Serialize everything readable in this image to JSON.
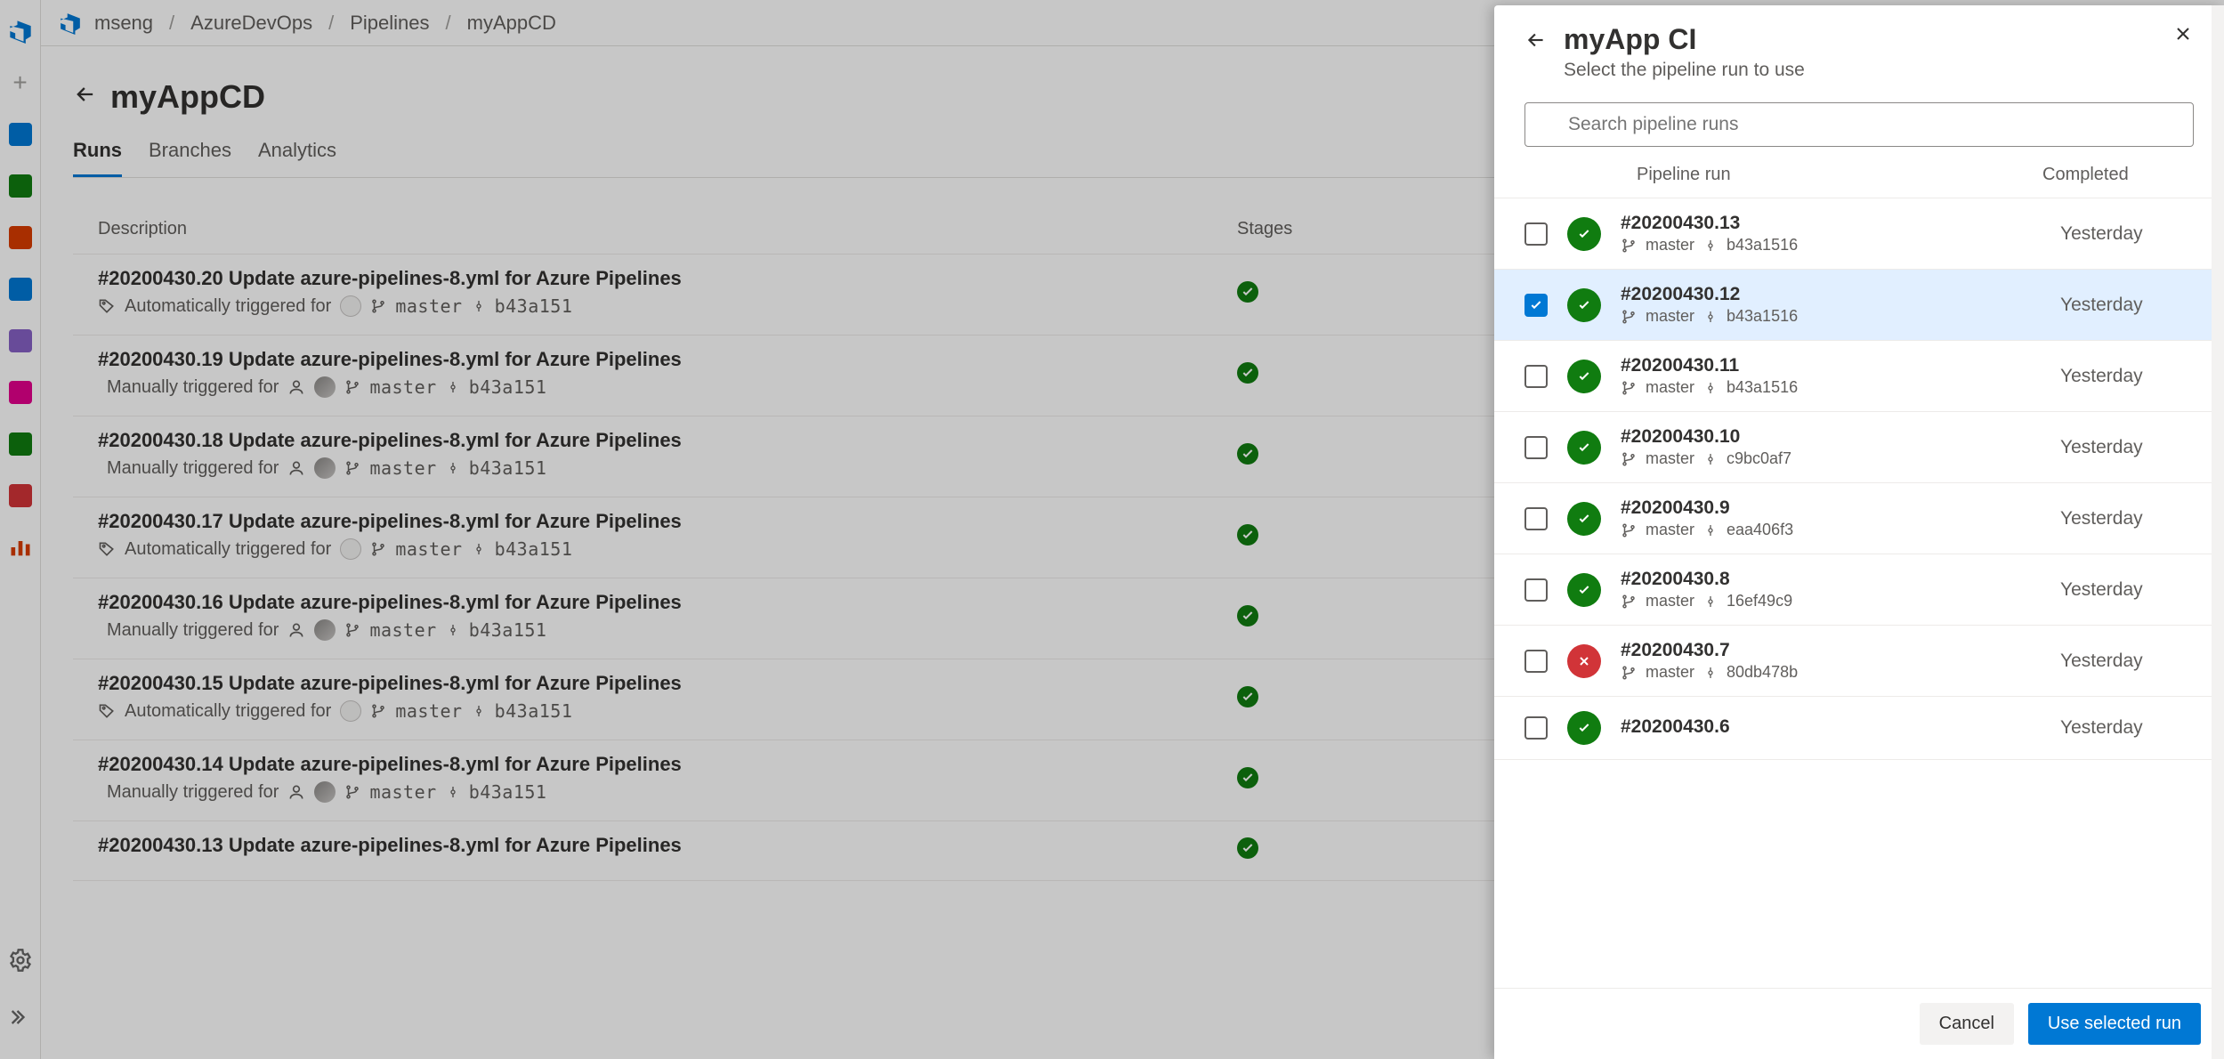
{
  "breadcrumbs": [
    "mseng",
    "AzureDevOps",
    "Pipelines",
    "myAppCD"
  ],
  "page": {
    "title": "myAppCD"
  },
  "tabs": [
    {
      "label": "Runs",
      "selected": true
    },
    {
      "label": "Branches",
      "selected": false
    },
    {
      "label": "Analytics",
      "selected": false
    }
  ],
  "runs_header": {
    "description": "Description",
    "stages": "Stages"
  },
  "runs": [
    {
      "title": "#20200430.20 Update azure-pipelines-8.yml for Azure Pipelines",
      "trigger": "Automatically triggered for",
      "trigger_icon": "app",
      "branch": "master",
      "commit": "b43a151",
      "status": "success"
    },
    {
      "title": "#20200430.19 Update azure-pipelines-8.yml for Azure Pipelines",
      "trigger": "Manually triggered for",
      "trigger_icon": "user",
      "branch": "master",
      "commit": "b43a151",
      "status": "success"
    },
    {
      "title": "#20200430.18 Update azure-pipelines-8.yml for Azure Pipelines",
      "trigger": "Manually triggered for",
      "trigger_icon": "user",
      "branch": "master",
      "commit": "b43a151",
      "status": "success"
    },
    {
      "title": "#20200430.17 Update azure-pipelines-8.yml for Azure Pipelines",
      "trigger": "Automatically triggered for",
      "trigger_icon": "app",
      "branch": "master",
      "commit": "b43a151",
      "status": "success"
    },
    {
      "title": "#20200430.16 Update azure-pipelines-8.yml for Azure Pipelines",
      "trigger": "Manually triggered for",
      "trigger_icon": "user",
      "branch": "master",
      "commit": "b43a151",
      "status": "success"
    },
    {
      "title": "#20200430.15 Update azure-pipelines-8.yml for Azure Pipelines",
      "trigger": "Automatically triggered for",
      "trigger_icon": "app",
      "branch": "master",
      "commit": "b43a151",
      "status": "success"
    },
    {
      "title": "#20200430.14 Update azure-pipelines-8.yml for Azure Pipelines",
      "trigger": "Manually triggered for",
      "trigger_icon": "user",
      "branch": "master",
      "commit": "b43a151",
      "status": "success"
    },
    {
      "title": "#20200430.13 Update azure-pipelines-8.yml for Azure Pipelines",
      "trigger": "",
      "trigger_icon": "",
      "branch": "",
      "commit": "",
      "status": "success"
    }
  ],
  "panel": {
    "title": "myApp CI",
    "subtitle": "Select the pipeline run to use",
    "search_placeholder": "Search pipeline runs",
    "col_run": "Pipeline run",
    "col_completed": "Completed",
    "cancel_label": "Cancel",
    "use_label": "Use selected run",
    "runs": [
      {
        "name": "#20200430.13",
        "branch": "master",
        "commit": "b43a1516",
        "completed": "Yesterday",
        "status": "success",
        "selected": false
      },
      {
        "name": "#20200430.12",
        "branch": "master",
        "commit": "b43a1516",
        "completed": "Yesterday",
        "status": "success",
        "selected": true
      },
      {
        "name": "#20200430.11",
        "branch": "master",
        "commit": "b43a1516",
        "completed": "Yesterday",
        "status": "success",
        "selected": false
      },
      {
        "name": "#20200430.10",
        "branch": "master",
        "commit": "c9bc0af7",
        "completed": "Yesterday",
        "status": "success",
        "selected": false
      },
      {
        "name": "#20200430.9",
        "branch": "master",
        "commit": "eaa406f3",
        "completed": "Yesterday",
        "status": "success",
        "selected": false
      },
      {
        "name": "#20200430.8",
        "branch": "master",
        "commit": "16ef49c9",
        "completed": "Yesterday",
        "status": "success",
        "selected": false
      },
      {
        "name": "#20200430.7",
        "branch": "master",
        "commit": "80db478b",
        "completed": "Yesterday",
        "status": "failed",
        "selected": false
      },
      {
        "name": "#20200430.6",
        "branch": "",
        "commit": "",
        "completed": "Yesterday",
        "status": "success",
        "selected": false
      }
    ]
  }
}
